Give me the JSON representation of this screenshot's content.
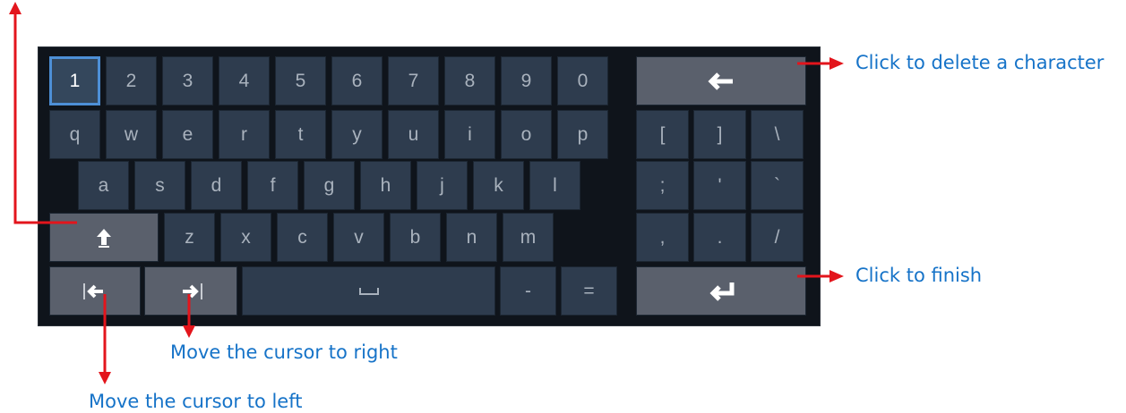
{
  "keyboard": {
    "row1": [
      "1",
      "2",
      "3",
      "4",
      "5",
      "6",
      "7",
      "8",
      "9",
      "0"
    ],
    "row2": [
      "q",
      "w",
      "e",
      "r",
      "t",
      "y",
      "u",
      "i",
      "o",
      "p"
    ],
    "row2_symbols": [
      "[",
      "]",
      "\\"
    ],
    "row3": [
      "a",
      "s",
      "d",
      "f",
      "g",
      "h",
      "j",
      "k",
      "l"
    ],
    "row3_symbols": [
      ";",
      "'",
      "`"
    ],
    "row4": [
      "z",
      "x",
      "c",
      "v",
      "b",
      "n",
      "m"
    ],
    "row4_symbols": [
      ",",
      ".",
      "/"
    ],
    "row5": [
      "-",
      "="
    ],
    "selected_key": "1"
  },
  "annotations": {
    "delete": "Click to delete a character",
    "finish": "Click to finish",
    "cursor_right": "Move the cursor to right",
    "cursor_left": "Move the cursor to left"
  },
  "colors": {
    "key": "#2e3c4e",
    "key_wide": "#5a606c",
    "keyboard_bg": "#0f141b",
    "selected_border": "#4d8fd6",
    "annotation_text": "#1673c8",
    "annotation_arrow": "#e3151c"
  }
}
